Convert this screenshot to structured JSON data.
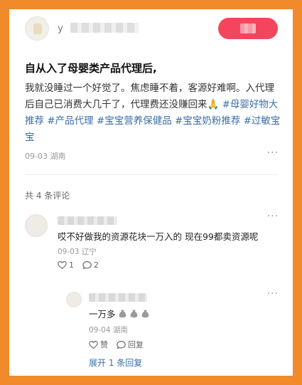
{
  "header": {
    "username_prefix": "у",
    "follow_label": ""
  },
  "post": {
    "title": "自从入了母婴类产品代理后,",
    "body_text": "我就没睡过一个好觉了。焦虑睡不着，客源好难啊。入代理后自己已消费大几千了，代理费还没赚回来",
    "tags": [
      "#母婴好物大推荐",
      "#产品代理",
      "#宝宝营养保健品",
      "#宝宝奶粉推荐",
      "#过敏宝宝"
    ],
    "date": "09-03",
    "location": "湖南",
    "more": "···"
  },
  "comments": {
    "count_label": "共 4 条评论",
    "items": [
      {
        "text": "哎不好做我的资源花块一万入的 现在99都卖资源呢",
        "date": "09-03",
        "location": "辽宁",
        "likes": "1",
        "replies": "2"
      }
    ],
    "reply": {
      "text": "一万多",
      "date": "09-04",
      "location": "湖南",
      "like_label": "赞",
      "reply_label": "回复"
    },
    "expand_label": "展开 1 条回复"
  },
  "colors": {
    "frame": "#f08a2a",
    "follow": "#f3465c",
    "tag": "#3b6fa8"
  }
}
